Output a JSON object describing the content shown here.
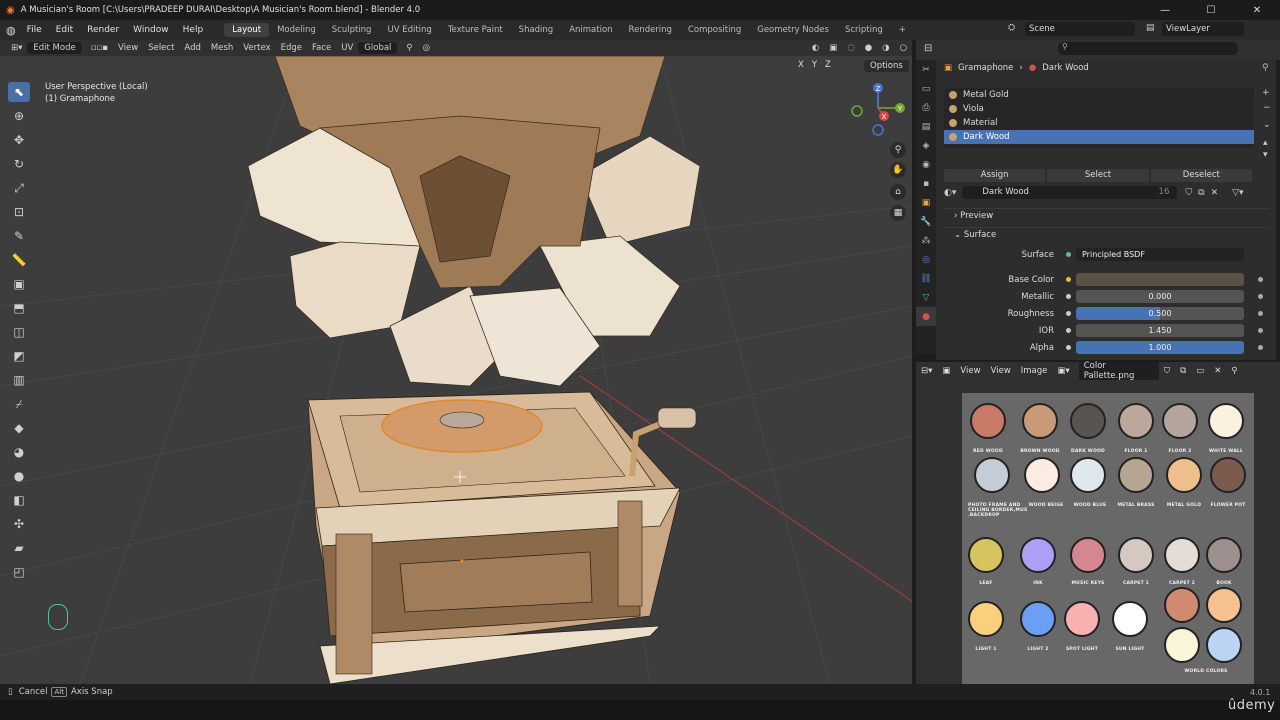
{
  "window": {
    "title": "A Musician's Room [C:\\Users\\PRADEEP DURAI\\Desktop\\A Musician's Room.blend] - Blender 4.0",
    "controls": [
      "—",
      "☐",
      "✕"
    ]
  },
  "menu": {
    "items": [
      "File",
      "Edit",
      "Render",
      "Window",
      "Help"
    ]
  },
  "workspaces": [
    "Layout",
    "Modeling",
    "Sculpting",
    "UV Editing",
    "Texture Paint",
    "Shading",
    "Animation",
    "Rendering",
    "Compositing",
    "Geometry Nodes",
    "Scripting",
    "+"
  ],
  "scene": {
    "scene_name": "Scene",
    "view_layer": "ViewLayer"
  },
  "viewport_header": {
    "mode": "Edit Mode",
    "menus": [
      "View",
      "Select",
      "Add",
      "Mesh",
      "Vertex",
      "Edge",
      "Face",
      "UV"
    ],
    "orientation": "Global",
    "options_label": "Options",
    "axes": [
      "X",
      "Y",
      "Z"
    ]
  },
  "viewport": {
    "perspective": "User Perspective (Local)",
    "object": "(1) Gramaphone"
  },
  "gizmo": {
    "x": "X",
    "y": "Y",
    "z": "Z"
  },
  "properties": {
    "breadcrumb": {
      "object": "Gramaphone",
      "material": "Dark Wood"
    },
    "materials": [
      "Metal Gold",
      "Viola",
      "Material",
      "Dark Wood"
    ],
    "selected_material_index": 3,
    "buttons": {
      "assign": "Assign",
      "select": "Select",
      "deselect": "Deselect"
    },
    "material_field": {
      "name": "Dark Wood",
      "users": "16"
    },
    "panels": {
      "preview": "Preview",
      "surface": "Surface"
    },
    "surface": {
      "label": "Surface",
      "shader": "Principled BSDF"
    },
    "fields": [
      {
        "label": "Base Color",
        "value": "",
        "kind": "color",
        "color": "#5a5246"
      },
      {
        "label": "Metallic",
        "value": "0.000",
        "kind": "slider",
        "fill": 0.0
      },
      {
        "label": "Roughness",
        "value": "0.500",
        "kind": "slider",
        "fill": 0.5
      },
      {
        "label": "IOR",
        "value": "1.450",
        "kind": "plain",
        "fill": 0.0
      },
      {
        "label": "Alpha",
        "value": "1.000",
        "kind": "slider",
        "fill": 1.0
      }
    ]
  },
  "image_editor": {
    "view_label": "View",
    "menus": [
      "View",
      "Image"
    ],
    "image_name": "Color Pallette.png"
  },
  "palette": [
    {
      "label": "RED WOOD",
      "color": "#c97a66"
    },
    {
      "label": "BROWN WOOD",
      "color": "#c89a78"
    },
    {
      "label": "DARK WOOD",
      "color": "#595450"
    },
    {
      "label": "FLOOR 1",
      "color": "#bda79c"
    },
    {
      "label": "FLOOR 2",
      "color": "#b5a49e"
    },
    {
      "label": "WHITE WALL",
      "color": "#fbf1df"
    },
    {
      "label": "PHOTO FRAME AND CEILING BORDER,MUS .BACKDROP",
      "color": "#c4cdd6"
    },
    {
      "label": "WOOD BEIGE",
      "color": "#fbebe0"
    },
    {
      "label": "WOOD BLUE",
      "color": "#dfe7ee"
    },
    {
      "label": "METAL BRASS",
      "color": "#b6a592"
    },
    {
      "label": "METAL GOLD",
      "color": "#eebe8c"
    },
    {
      "label": "FLOWER POT",
      "color": "#7a5b4e"
    },
    {
      "label": "LEAF",
      "color": "#d8c45e"
    },
    {
      "label": "INK",
      "color": "#ad9ff5"
    },
    {
      "label": "MUSIC KEYS",
      "color": "#d6868e"
    },
    {
      "label": "CARPET 1",
      "color": "#d5c8c1"
    },
    {
      "label": "CARPET 2",
      "color": "#e6dcd7"
    },
    {
      "label": "BOOK",
      "color": "#9c8f8e"
    },
    {
      "label": "LIGHT 1",
      "color": "#fbd07c"
    },
    {
      "label": "LIGHT 2",
      "color": "#6b9ff2"
    },
    {
      "label": "SPOT LIGHT",
      "color": "#f9b0b0"
    },
    {
      "label": "SUN LIGHT",
      "color": "#ffffff"
    },
    {
      "label": "WORLD COLORS",
      "color": "#d08a6f"
    },
    {
      "label": "",
      "color": "#f6c08f"
    },
    {
      "label": "",
      "color": "#faf4d8"
    },
    {
      "label": "",
      "color": "#bcd3f3"
    }
  ],
  "status": {
    "cancel": "Cancel",
    "alt_key": "Alt",
    "axis_snap": "Axis Snap",
    "version": "4.0.1"
  },
  "watermark": "ûdemy"
}
